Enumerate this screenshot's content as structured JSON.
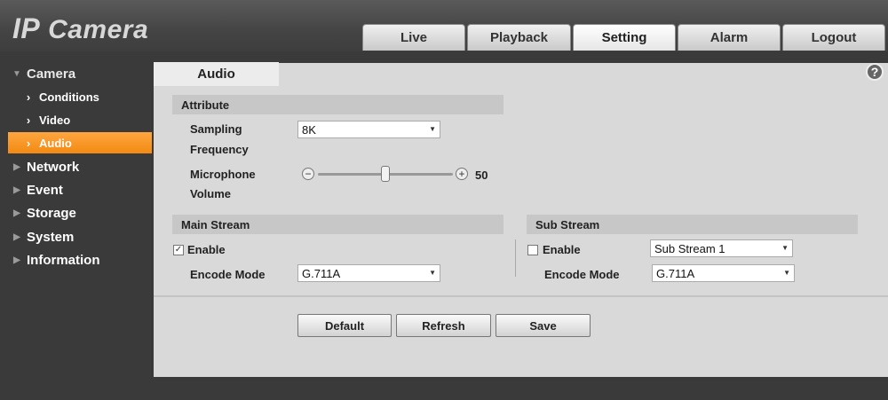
{
  "app": {
    "title_ip": "IP",
    "title_rest": "Camera"
  },
  "nav": {
    "tabs": [
      "Live",
      "Playback",
      "Setting",
      "Alarm",
      "Logout"
    ],
    "active": "Setting"
  },
  "sidebar": {
    "camera": "Camera",
    "conditions": "Conditions",
    "video": "Video",
    "audio": "Audio",
    "network": "Network",
    "event": "Event",
    "storage": "Storage",
    "system": "System",
    "information": "Information"
  },
  "page": {
    "tab": "Audio",
    "help": "?"
  },
  "attribute": {
    "header": "Attribute",
    "sampling_label_1": "Sampling",
    "sampling_label_2": "Frequency",
    "sampling_value": "8K",
    "mic_label_1": "Microphone",
    "mic_label_2": "Volume",
    "mic_value": "50",
    "mic_value_max": 100
  },
  "main_stream": {
    "header": "Main Stream",
    "enable_label": "Enable",
    "enabled": true,
    "encode_label": "Encode Mode",
    "encode_value": "G.711A"
  },
  "sub_stream": {
    "header": "Sub Stream",
    "enable_label": "Enable",
    "enabled": false,
    "stream_value": "Sub Stream 1",
    "encode_label": "Encode Mode",
    "encode_value": "G.711A"
  },
  "buttons": {
    "default": "Default",
    "refresh": "Refresh",
    "save": "Save"
  },
  "colors": {
    "accent": "#f28a12",
    "panel": "#d9d9d9",
    "section": "#c7c7c7",
    "sidebar": "#3a3a3a"
  }
}
